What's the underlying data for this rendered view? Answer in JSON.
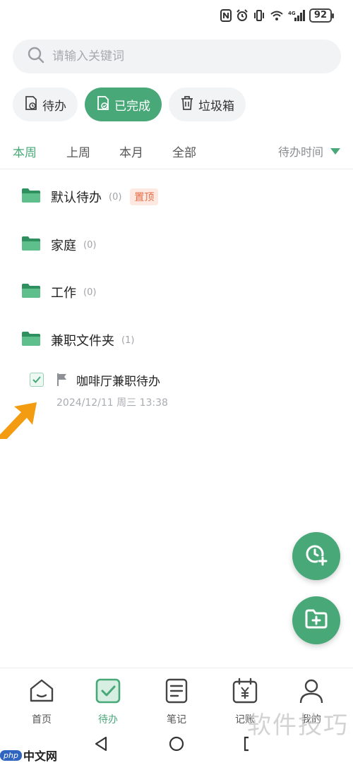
{
  "status_bar": {
    "battery": "92",
    "network": "4G"
  },
  "search": {
    "placeholder": "请输入关键词"
  },
  "chips": [
    {
      "label": "待办",
      "icon": "todo-doc-icon",
      "active": false
    },
    {
      "label": "已完成",
      "icon": "done-doc-icon",
      "active": true
    },
    {
      "label": "垃圾箱",
      "icon": "trash-icon",
      "active": false
    }
  ],
  "period_tabs": [
    {
      "label": "本周",
      "active": true
    },
    {
      "label": "上周",
      "active": false
    },
    {
      "label": "本月",
      "active": false
    },
    {
      "label": "全部",
      "active": false
    }
  ],
  "sort": {
    "label": "待办时间"
  },
  "folders": [
    {
      "name": "默认待办",
      "count": "(0)",
      "badge": "置顶"
    },
    {
      "name": "家庭",
      "count": "(0)"
    },
    {
      "name": "工作",
      "count": "(0)"
    },
    {
      "name": "兼职文件夹",
      "count": "(1)"
    }
  ],
  "task": {
    "title": "咖啡厅兼职待办",
    "time": "2024/12/11 周三 13:38",
    "checked": true
  },
  "bottom_nav": [
    {
      "label": "首页",
      "icon": "home-icon",
      "active": false
    },
    {
      "label": "待办",
      "icon": "todo-check-icon",
      "active": true
    },
    {
      "label": "笔记",
      "icon": "note-icon",
      "active": false
    },
    {
      "label": "记账",
      "icon": "ledger-icon",
      "active": false
    },
    {
      "label": "我的",
      "icon": "profile-icon",
      "active": false
    }
  ],
  "watermark": {
    "left_logo": "php",
    "left_text": "中文网",
    "right_text": "软件技巧"
  },
  "colors": {
    "accent": "#48a878",
    "pin_bg": "#fde9e1",
    "pin_text": "#e56b45",
    "arrow": "#f39c12"
  }
}
